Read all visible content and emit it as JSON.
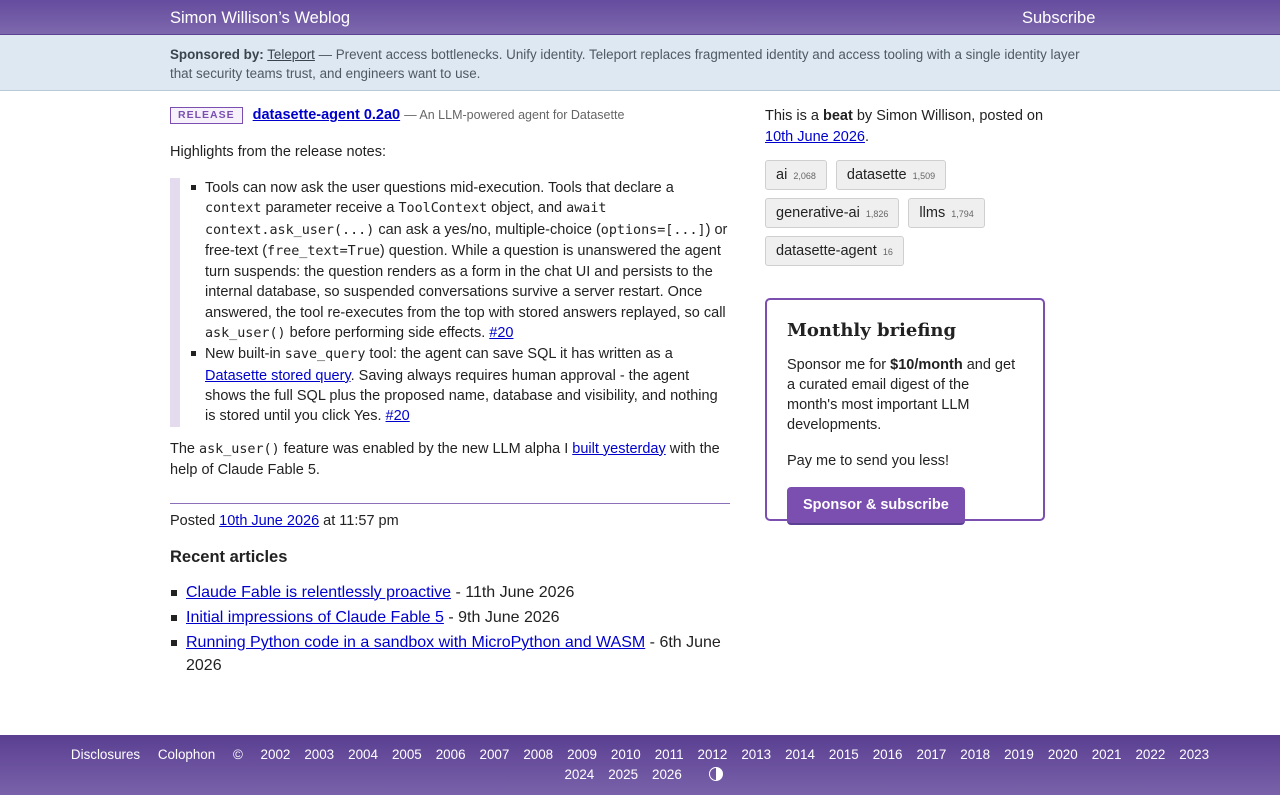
{
  "header": {
    "site_title": "Simon Willison’s Weblog",
    "subscribe_label": "Subscribe"
  },
  "sponsor_banner": {
    "label": "Sponsored by:",
    "sponsor_name": "Teleport",
    "message": " — Prevent access bottlenecks. Unify identity. Teleport replaces fragmented identity and access tooling with a single identity layer that security teams trust, and engineers want to use."
  },
  "post": {
    "badge": "RELEASE",
    "title": "datasette-agent 0.2a0",
    "description": "— An LLM-powered agent for Datasette",
    "intro": "Highlights from the release notes:",
    "notes": [
      {
        "t1": "Tools can now ask the user questions mid-execution. Tools that declare a ",
        "c1": "context",
        "t2": " parameter receive a ",
        "c2": "ToolContext",
        "t3": " object, and ",
        "c3": "await context.ask_user(...)",
        "t4": " can ask a yes/no, multiple-choice (",
        "c4": "options=[...]",
        "t5": ") or free-text (",
        "c5": "free_text=True",
        "t6": ") question. While a question is unanswered the agent turn suspends: the question renders as a form in the chat UI and persists to the internal database, so suspended conversations survive a server restart. Once answered, the tool re-executes from the top with stored answers replayed, so call ",
        "c6": "ask_user()",
        "t7": " before performing side effects. ",
        "link": "#20"
      },
      {
        "t1": "New built-in ",
        "c1": "save_query",
        "t2": " tool: the agent can save SQL it has written as a ",
        "link1": "Datasette stored query",
        "t3": ". Saving always requires human approval - the agent shows the full SQL plus the proposed name, database and visibility, and nothing is stored until you click Yes. ",
        "link": "#20"
      }
    ],
    "closing": {
      "t1": "The ",
      "c1": "ask_user()",
      "t2": " feature was enabled by the new LLM alpha I ",
      "link": "built yesterday",
      "t3": " with the help of Claude Fable 5."
    },
    "posted": {
      "prefix": "Posted ",
      "date": "10th June 2026",
      "suffix": " at 11:57 pm"
    }
  },
  "recent": {
    "heading": "Recent articles",
    "items": [
      {
        "title": "Claude Fable is relentlessly proactive",
        "date": " - 11th June 2026"
      },
      {
        "title": "Initial impressions of Claude Fable 5",
        "date": " - 9th June 2026"
      },
      {
        "title": "Running Python code in a sandbox with MicroPython and WASM",
        "date": " - 6th June 2026"
      }
    ]
  },
  "sidebar": {
    "beat": {
      "t1": "This is a ",
      "bold": "beat",
      "t2": " by Simon Willison, posted on ",
      "date": "10th June 2026",
      "t3": "."
    },
    "tags": [
      {
        "name": "ai",
        "count": "2,068"
      },
      {
        "name": "datasette",
        "count": "1,509"
      },
      {
        "name": "generative-ai",
        "count": "1,826"
      },
      {
        "name": "llms",
        "count": "1,794"
      },
      {
        "name": "datasette-agent",
        "count": "16"
      }
    ],
    "briefing": {
      "title": "Monthly briefing",
      "t1": "Sponsor me for ",
      "price": "$10/month",
      "t2": " and get a curated email digest of the month's most important LLM developments.",
      "pay_text": "Pay me to send you less!",
      "button_label": "Sponsor & subscribe"
    }
  },
  "footer": {
    "links": [
      "Disclosures",
      "Colophon"
    ],
    "copyright": "©",
    "years_line1": [
      "2002",
      "2003",
      "2004",
      "2005",
      "2006",
      "2007",
      "2008",
      "2009",
      "2010",
      "2011",
      "2012",
      "2013",
      "2014",
      "2015",
      "2016",
      "2017",
      "2018",
      "2019",
      "2020",
      "2021",
      "2022",
      "2023"
    ],
    "years_line2": [
      "2024",
      "2025",
      "2026"
    ],
    "contrast_icon": "contrast-icon"
  },
  "colors": {
    "brand_purple": "#7a4fb0",
    "header_bg": "#664c9e",
    "banner_bg": "#dde8f2",
    "link": "#0000cc"
  }
}
